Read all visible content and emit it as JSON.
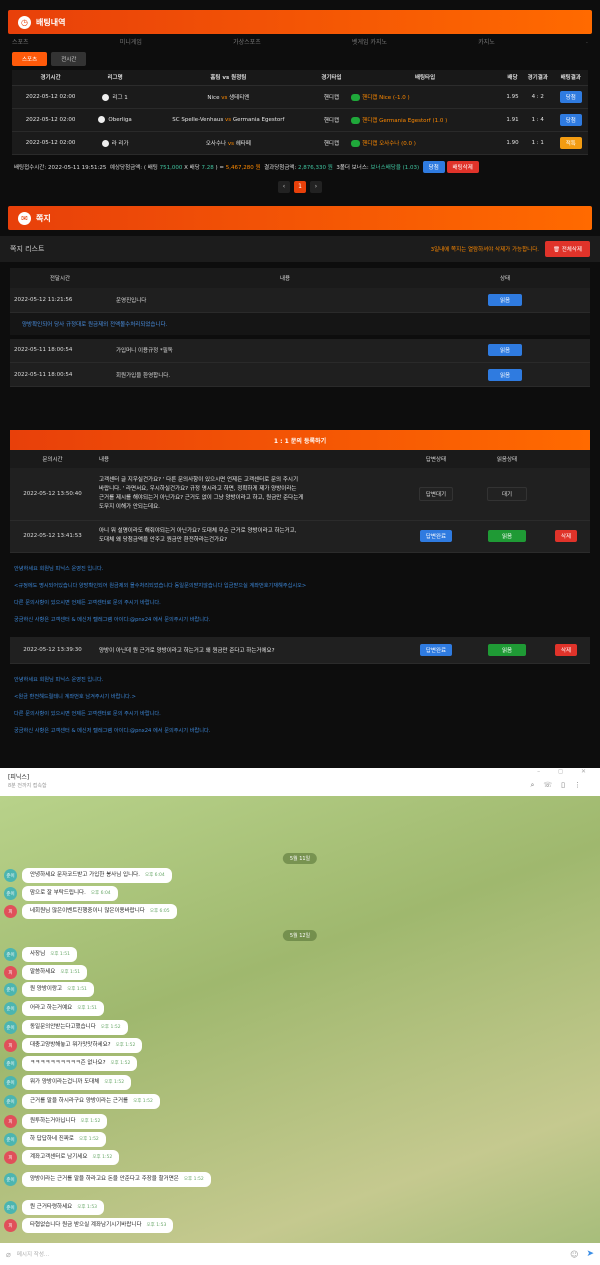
{
  "betting": {
    "title": "배팅내역",
    "categories": [
      "스포츠",
      "미니게임",
      "가상스포츠",
      "벳게임 카지노",
      "카지노",
      "."
    ],
    "tabs": [
      "스포츠",
      "전시간"
    ],
    "headers": [
      "경기시간",
      "리그명",
      "홈팀 vs 원정팀",
      "경기타입",
      "배팅타입",
      "배당",
      "경기결과",
      "배팅결과"
    ],
    "rows": [
      {
        "time": "2022-05-12 02:00",
        "league": "리그 1",
        "home": "Nice",
        "vs": "vs",
        "away": "생테티엔",
        "type": "핸디캡",
        "bet": "핸디캡 Nice (-1.0 )",
        "odds": "1.95",
        "score": "4 : 2",
        "result": "당첨",
        "rcolor": "blue"
      },
      {
        "time": "2022-05-12 02:00",
        "league": "Oberliga",
        "home": "SC Spelle-Venhaus",
        "vs": "vs",
        "away": "Germania Egestorf",
        "type": "핸디캡",
        "bet": "핸디캡 Germania Egestorf (1.0 )",
        "odds": "1.91",
        "score": "1 : 4",
        "result": "당첨",
        "rcolor": "blue"
      },
      {
        "time": "2022-05-12 02:00",
        "league": "라 리가",
        "home": "오사수나",
        "vs": "vs",
        "away": "헤타페",
        "type": "핸디캡",
        "bet": "핸디캡 오사수나 (0.0 )",
        "odds": "1.90",
        "score": "1 : 1",
        "result": "적특",
        "rcolor": "orange"
      }
    ],
    "summary": {
      "p1": "배팅접수시간: 2022-05-11 19:51:25",
      "p2": "예상당첨금액: ( 배팅 ",
      "bet": "751,000",
      "p3": " X 배당 ",
      "odds": "7.28",
      "p4": " ) = ",
      "win": "5,467,280 원",
      "p5": "결과당첨금액: ",
      "res": "2,876,330 원",
      "p6": "3폴더 보너스: ",
      "bonus": "보너스배당율 (1.03)",
      "b1": "당첨",
      "b2": "배팅삭제"
    },
    "pager": [
      "‹",
      "1",
      "›"
    ]
  },
  "notes": {
    "title": "쪽지",
    "list_title": "쪽지 리스트",
    "notice": "3일내에 쪽지는 열람하셔야 삭제가 가능합니다.",
    "delete_all": "전체삭제",
    "headers": [
      "전달시간",
      "내용",
      "상태"
    ],
    "rows": [
      {
        "time": "2022-05-12 11:21:56",
        "content": "운영진입니다",
        "state": "읽음"
      },
      {
        "time": "2022-05-11 18:00:54",
        "content": "가입머니 이용규정 *필독",
        "state": "읽음"
      },
      {
        "time": "2022-05-11 18:00:54",
        "content": "회원가입을 환영합니다.",
        "state": "읽음"
      }
    ],
    "sub": "양방확인되어 당사 규정대로 원금제외 전액몰수처리되었습니다."
  },
  "inquiry": {
    "title": "1 : 1 문의 등록하기",
    "headers": [
      "문의시간",
      "내용",
      "답변상태",
      "읽음상태"
    ],
    "rows": [
      {
        "time": "2022-05-12 13:50:40",
        "l1": "고객센터 글 지우실건가요? ' 다른 문의사항이 있으시면 언제든 고객센터로 문의 주시기",
        "l2": "바랍니다. ' 라면서요, 우시하실건가요? 규정 명시라고 하면, 정확하게 제가 양방이라는",
        "l3": "근거를 제시를 해야되는거 아닌가요? 근거도 없이 그냥 양방이라고 하고, 원금만 준다는게",
        "l4": "도무지 이해가 안되는데요.",
        "answer": "답변대기",
        "read": "대기"
      },
      {
        "time": "2022-05-12 13:41:53",
        "l1": "아니 뭐 설명이라도 해줘야되는거 아닌가요? 도대체 무슨 근거로 양방이라고 하는거고,",
        "l2": "도대체 왜 당첨금액을 안주고 원금만 환전하라는건가요?",
        "answer": "답변완료",
        "read": "읽음",
        "del": "삭제"
      },
      {
        "time": "2022-05-12 13:39:30",
        "l1": "양방이 아닌데 뭔 근거로 양방이라고 하는거고 왜 원금만 준다고 하는거에요?",
        "answer": "답변완료",
        "read": "읽음",
        "del": "삭제"
      }
    ],
    "reply1": [
      "안녕하세요 회원님 피닉스 운영진 입니다.",
      "<규정에도 명시되어있습니다 양방확인되어 원금제외 몰수처리되었습니다 동일문의받지않습니다 입금받으실 계좌번호기재해주십시오>",
      "다른 문의사항이 있으시면 언제든 고객센터로 문의 주시기 바랍니다.",
      "궁금하신 사항은 고객센터 & 메신저 텔레그램 아이디:@pnx24 에서 문의주시기 바랍니다."
    ],
    "reply2": [
      "안녕하세요 회원님 피닉스 운영진 입니다.",
      "<원금 환전해드릴테니 계좌번호 남겨주시기 바랍니다.>",
      "다른 문의사항이 있으시면 언제든 고객센터로 문의 주시기 바랍니다.",
      "궁금하신 사항은 고객센터 & 메신저 텔레그램 아이디:@pnx24 에서 문의주시기 바랍니다."
    ]
  },
  "telegram": {
    "title": "[피닉스]",
    "status": "8분 전까지 접속함",
    "date1": "5월 11일",
    "date2": "5월 12일",
    "messages": [
      {
        "who": "a",
        "text": "안녕하세요 문자코드받고 가입한 봉사님 입니다.",
        "time": "오후 6:04"
      },
      {
        "who": "a",
        "text": "맘으로 잘 부탁드립니다.",
        "time": "오후 6:04"
      },
      {
        "who": "b",
        "text": "네회원님 많은이벤트진행중이니 많은이용바랍니다",
        "time": "오후 6:05"
      },
      {
        "who": "a",
        "text": "사장님",
        "time": "오후 1:51"
      },
      {
        "who": "b",
        "text": "말씀하세요",
        "time": "오후 1:51"
      },
      {
        "who": "a",
        "text": "원 양방이랑고",
        "time": "오후 1:51"
      },
      {
        "who": "a",
        "text": "어라고 하는거예요",
        "time": "오후 1:51"
      },
      {
        "who": "a",
        "text": "동일문의안받는다고했습니다",
        "time": "오후 1:52"
      },
      {
        "who": "b",
        "text": "대충고양방해놓고 뭐가맛맛하세요?",
        "time": "오후 1:52"
      },
      {
        "who": "a",
        "text": "ㅋㅋㅋㅋㅋㅋㅋㅋㅋㅋ즌 없나요?",
        "time": "오후 1:52"
      },
      {
        "who": "a",
        "text": "뭐가 양방이라는겁니까 도대체",
        "time": "오후 1:52"
      },
      {
        "who": "a",
        "text": "근거를 말을 하시라구요 양방이라는 근거를",
        "time": "오후 1:52"
      },
      {
        "who": "b",
        "text": "원투하는거아닙니다",
        "time": "오후 1:52"
      },
      {
        "who": "a",
        "text": "하 답답하네 진짜로",
        "time": "오후 1:52"
      },
      {
        "who": "b",
        "text": "계좌고객센터로 남기세요",
        "time": "오후 1:52"
      },
      {
        "who": "a",
        "text": "양방이라는 근거를 말을 하라고요 돈을 안준다고 주장을 할거면은",
        "time": "오후 1:52"
      },
      {
        "who": "a",
        "text": "뭔 근거타령하세요",
        "time": "오후 1:53"
      },
      {
        "who": "b",
        "text": "타협없습니다 원금 받으실 계좌남기시기바랍니다",
        "time": "오후 1:53"
      }
    ],
    "avatar_a": "준이",
    "avatar_b": "피",
    "input_placeholder": "메시지 작성..."
  }
}
